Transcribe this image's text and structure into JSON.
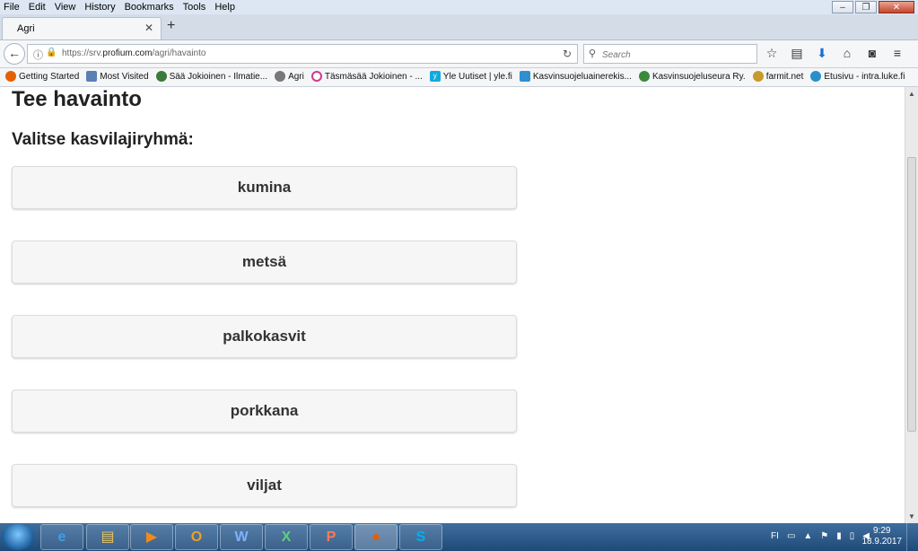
{
  "menubar": {
    "items": [
      "File",
      "Edit",
      "View",
      "History",
      "Bookmarks",
      "Tools",
      "Help"
    ]
  },
  "window_controls": {
    "minimize": "–",
    "maximize": "❐",
    "close": "✕"
  },
  "tab": {
    "title": "Agri",
    "close": "✕",
    "new_tab": "+"
  },
  "navbar": {
    "url_prefix": "https://srv.",
    "url_domain": "profium.com",
    "url_path": "/agri/havainto",
    "search_placeholder": "Search"
  },
  "bookmarks": [
    {
      "label": "Getting Started",
      "icon": "firefox-icon",
      "color": "#e66000"
    },
    {
      "label": "Most Visited",
      "icon": "bookmark-folder-icon",
      "color": "#5a7fb5"
    },
    {
      "label": "Sää Jokioinen - Ilmatie...",
      "icon": "weather-globe-icon",
      "color": "#3a7a3a"
    },
    {
      "label": "Agri",
      "icon": "globe-icon",
      "color": "#777777"
    },
    {
      "label": "Täsmäsää Jokioinen - ...",
      "icon": "circle-icon",
      "color": "#d03a8a"
    },
    {
      "label": "Yle Uutiset | yle.fi",
      "icon": "yle-icon",
      "color": "#11aadd"
    },
    {
      "label": "Kasvinsuojeluainerekis...",
      "icon": "tukes-icon",
      "color": "#2f8fcf"
    },
    {
      "label": "Kasvinsuojeluseura Ry.",
      "icon": "leaf-icon",
      "color": "#3a8a3a"
    },
    {
      "label": "farmit.net",
      "icon": "farmit-icon",
      "color": "#c89a2a"
    },
    {
      "label": "Etusivu - intra.luke.fi",
      "icon": "chat-icon",
      "color": "#2a8fc8"
    }
  ],
  "page": {
    "title": "Tee havainto",
    "subtitle": "Valitse kasvilajiryhmä:",
    "groups": [
      "kumina",
      "metsä",
      "palkokasvit",
      "porkkana",
      "viljat"
    ]
  },
  "taskbar": {
    "apps": [
      {
        "icon": "internet-explorer-icon",
        "glyph": "e",
        "color": "#3aa0e8"
      },
      {
        "icon": "file-explorer-icon",
        "glyph": "▤",
        "color": "#e8c560"
      },
      {
        "icon": "media-player-icon",
        "glyph": "▶",
        "color": "#f08a1a"
      },
      {
        "icon": "outlook-icon",
        "glyph": "O",
        "color": "#f0a020"
      },
      {
        "icon": "word-icon",
        "glyph": "W",
        "color": "#2b5fb4"
      },
      {
        "icon": "excel-icon",
        "glyph": "X",
        "color": "#1f8a3a"
      },
      {
        "icon": "powerpoint-icon",
        "glyph": "P",
        "color": "#d24a26"
      },
      {
        "icon": "firefox-icon",
        "glyph": "●",
        "color": "#e66000"
      },
      {
        "icon": "skype-icon",
        "glyph": "S",
        "color": "#00aff0"
      }
    ],
    "language": "FI",
    "time": "9:29",
    "date": "18.9.2017"
  }
}
